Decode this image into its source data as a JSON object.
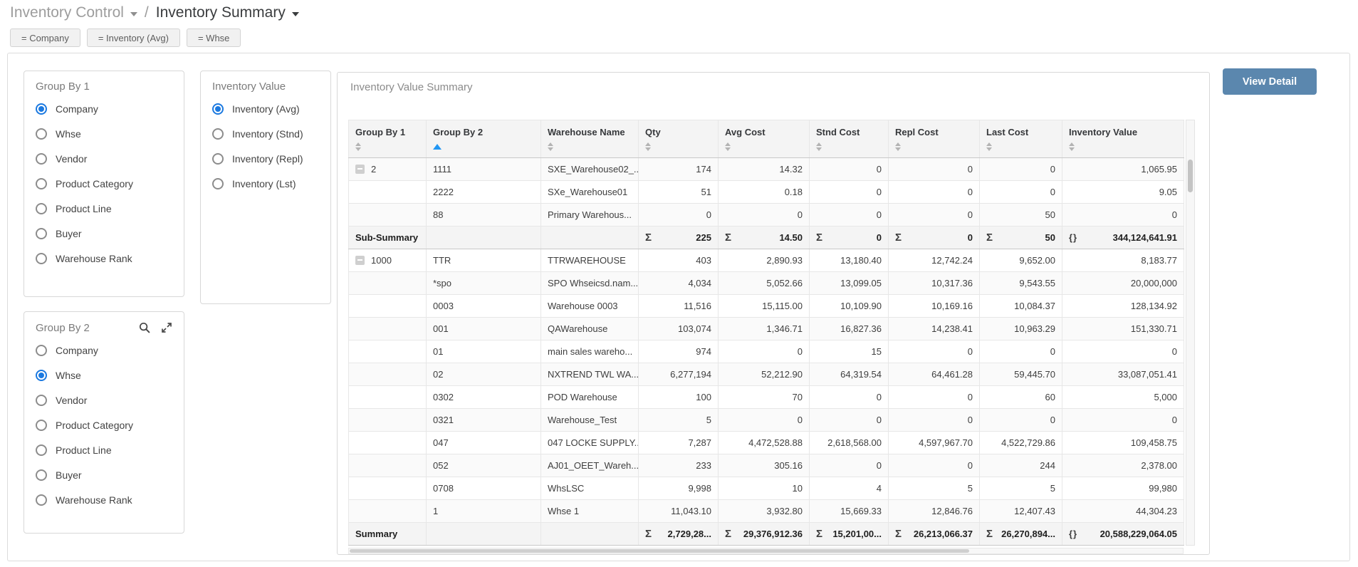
{
  "breadcrumb": {
    "section": "Inventory Control",
    "separator": "/",
    "page": "Inventory Summary"
  },
  "filter_chips": [
    {
      "label": "= Company"
    },
    {
      "label": "= Inventory (Avg)"
    },
    {
      "label": "= Whse"
    }
  ],
  "group_by_1": {
    "title": "Group By 1",
    "options": [
      {
        "label": "Company",
        "selected": true
      },
      {
        "label": "Whse",
        "selected": false
      },
      {
        "label": "Vendor",
        "selected": false
      },
      {
        "label": "Product Category",
        "selected": false
      },
      {
        "label": "Product Line",
        "selected": false
      },
      {
        "label": "Buyer",
        "selected": false
      },
      {
        "label": "Warehouse Rank",
        "selected": false
      }
    ]
  },
  "inventory_value": {
    "title": "Inventory Value",
    "options": [
      {
        "label": "Inventory (Avg)",
        "selected": true
      },
      {
        "label": "Inventory (Stnd)",
        "selected": false
      },
      {
        "label": "Inventory (Repl)",
        "selected": false
      },
      {
        "label": "Inventory (Lst)",
        "selected": false
      }
    ]
  },
  "group_by_2": {
    "title": "Group By 2",
    "tool_icons": [
      "search",
      "expand"
    ],
    "options": [
      {
        "label": "Company",
        "selected": false
      },
      {
        "label": "Whse",
        "selected": true
      },
      {
        "label": "Vendor",
        "selected": false
      },
      {
        "label": "Product Category",
        "selected": false
      },
      {
        "label": "Product Line",
        "selected": false
      },
      {
        "label": "Buyer",
        "selected": false
      },
      {
        "label": "Warehouse Rank",
        "selected": false
      }
    ]
  },
  "view_detail_button": {
    "label": "View Detail",
    "color": "#5b87ae"
  },
  "table": {
    "title": "Inventory Value Summary",
    "sigma_icon": "Σ",
    "braces_icon": "{}",
    "sorted_column": "Group By 2",
    "sort_direction": "asc",
    "columns": [
      {
        "label": "Group By 1",
        "sort": "none"
      },
      {
        "label": "Group By 2",
        "sort": "asc"
      },
      {
        "label": "Warehouse Name",
        "sort": "none"
      },
      {
        "label": "Qty",
        "sort": "none"
      },
      {
        "label": "Avg Cost",
        "sort": "none"
      },
      {
        "label": "Stnd Cost",
        "sort": "none"
      },
      {
        "label": "Repl Cost",
        "sort": "none"
      },
      {
        "label": "Last Cost",
        "sort": "none"
      },
      {
        "label": "Inventory Value",
        "sort": "none"
      }
    ],
    "rows": [
      {
        "type": "data",
        "group1": "2",
        "group2": "1111",
        "warehouse": "SXE_Warehouse02_...",
        "qty": "174",
        "avg_cost": "14.32",
        "stnd_cost": "0",
        "repl_cost": "0",
        "last_cost": "0",
        "inventory_value": "1,065.95"
      },
      {
        "type": "data",
        "group2": "2222",
        "warehouse": "SXe_Warehouse01",
        "qty": "51",
        "avg_cost": "0.18",
        "stnd_cost": "0",
        "repl_cost": "0",
        "last_cost": "0",
        "inventory_value": "9.05"
      },
      {
        "type": "data",
        "group2": "88",
        "warehouse": "Primary Warehous...",
        "qty": "0",
        "avg_cost": "0",
        "stnd_cost": "0",
        "repl_cost": "0",
        "last_cost": "50",
        "inventory_value": "0"
      },
      {
        "type": "sub_summary",
        "label": "Sub-Summary",
        "qty": "225",
        "avg_cost": "14.50",
        "stnd_cost": "0",
        "repl_cost": "0",
        "last_cost": "50",
        "inventory_value": "344,124,641.91"
      },
      {
        "type": "data",
        "group1": "1000",
        "group2": "TTR",
        "warehouse": "TTRWAREHOUSE",
        "qty": "403",
        "avg_cost": "2,890.93",
        "stnd_cost": "13,180.40",
        "repl_cost": "12,742.24",
        "last_cost": "9,652.00",
        "inventory_value": "8,183.77"
      },
      {
        "type": "data",
        "group2": "*spo",
        "warehouse": "SPO Whseicsd.nam...",
        "qty": "4,034",
        "avg_cost": "5,052.66",
        "stnd_cost": "13,099.05",
        "repl_cost": "10,317.36",
        "last_cost": "9,543.55",
        "inventory_value": "20,000,000"
      },
      {
        "type": "data",
        "group2": "0003",
        "warehouse": "Warehouse 0003",
        "qty": "11,516",
        "avg_cost": "15,115.00",
        "stnd_cost": "10,109.90",
        "repl_cost": "10,169.16",
        "last_cost": "10,084.37",
        "inventory_value": "128,134.92"
      },
      {
        "type": "data",
        "group2": "001",
        "warehouse": "QAWarehouse",
        "qty": "103,074",
        "avg_cost": "1,346.71",
        "stnd_cost": "16,827.36",
        "repl_cost": "14,238.41",
        "last_cost": "10,963.29",
        "inventory_value": "151,330.71"
      },
      {
        "type": "data",
        "group2": "01",
        "warehouse": "main sales wareho...",
        "qty": "974",
        "avg_cost": "0",
        "stnd_cost": "15",
        "repl_cost": "0",
        "last_cost": "0",
        "inventory_value": "0"
      },
      {
        "type": "data",
        "group2": "02",
        "warehouse": "NXTREND TWL WA...",
        "qty": "6,277,194",
        "avg_cost": "52,212.90",
        "stnd_cost": "64,319.54",
        "repl_cost": "64,461.28",
        "last_cost": "59,445.70",
        "inventory_value": "33,087,051.41"
      },
      {
        "type": "data",
        "group2": "0302",
        "warehouse": "POD Warehouse",
        "qty": "100",
        "avg_cost": "70",
        "stnd_cost": "0",
        "repl_cost": "0",
        "last_cost": "60",
        "inventory_value": "5,000"
      },
      {
        "type": "data",
        "group2": "0321",
        "warehouse": "Warehouse_Test",
        "qty": "5",
        "avg_cost": "0",
        "stnd_cost": "0",
        "repl_cost": "0",
        "last_cost": "0",
        "inventory_value": "0"
      },
      {
        "type": "data",
        "group2": "047",
        "warehouse": "047 LOCKE SUPPLY...",
        "qty": "7,287",
        "avg_cost": "4,472,528.88",
        "stnd_cost": "2,618,568.00",
        "repl_cost": "4,597,967.70",
        "last_cost": "4,522,729.86",
        "inventory_value": "109,458.75"
      },
      {
        "type": "data",
        "group2": "052",
        "warehouse": "AJ01_OEET_Wareh...",
        "qty": "233",
        "avg_cost": "305.16",
        "stnd_cost": "0",
        "repl_cost": "0",
        "last_cost": "244",
        "inventory_value": "2,378.00"
      },
      {
        "type": "data",
        "group2": "0708",
        "warehouse": "WhsLSC",
        "qty": "9,998",
        "avg_cost": "10",
        "stnd_cost": "4",
        "repl_cost": "5",
        "last_cost": "5",
        "inventory_value": "99,980"
      },
      {
        "type": "data",
        "group2": "1",
        "warehouse": "Whse 1",
        "qty": "11,043.10",
        "avg_cost": "3,932.80",
        "stnd_cost": "15,669.33",
        "repl_cost": "12,846.76",
        "last_cost": "12,407.43",
        "inventory_value": "44,304.23"
      },
      {
        "type": "summary",
        "label": "Summary",
        "qty": "2,729,28...",
        "avg_cost": "29,376,912.36",
        "stnd_cost": "15,201,00...",
        "repl_cost": "26,213,066.37",
        "last_cost": "26,270,894...",
        "inventory_value": "20,588,229,064.05"
      }
    ]
  },
  "colors": {
    "radio_selected": "#1b79e0",
    "sort_active": "#2196f3",
    "button_blue": "#5b87ae",
    "header_bg": "#f4f4f4"
  }
}
